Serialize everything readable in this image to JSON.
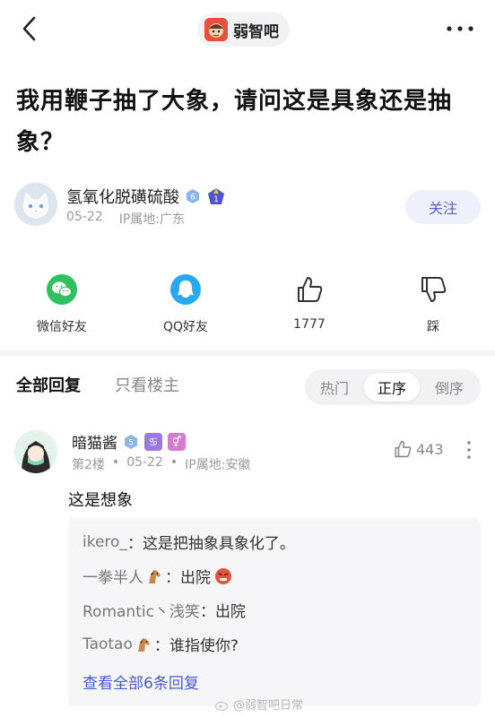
{
  "topbar": {
    "forum_name": "弱智吧"
  },
  "post": {
    "title": "我用鞭子抽了大象，请问这是具象还是抽象？"
  },
  "author": {
    "name": "氢氧化脱磺硫酸",
    "level": "6",
    "date": "05-22",
    "ip": "IP属地:广东",
    "follow_label": "关注"
  },
  "actions": {
    "wechat": "微信好友",
    "qq": "QQ好友",
    "likes": "1777",
    "dislike": "踩"
  },
  "reply_tabs": {
    "all": "全部回复",
    "op_only": "只看楼主",
    "sort": [
      "热门",
      "正序",
      "倒序"
    ],
    "active_sort": "正序"
  },
  "comment": {
    "name": "暗猫酱",
    "level": "5",
    "floor": "第2楼",
    "date": "05-22",
    "ip": "IP属地:安徽",
    "likes": "443",
    "text": "这是想象",
    "sub_replies": [
      {
        "user": "ikero_",
        "text": "这是把抽象具象化了。",
        "emoji": ""
      },
      {
        "user": "一拳半人",
        "text": "出院",
        "emoji": ""
      },
      {
        "user": "Romantic丶浅笑",
        "text": "出院",
        "emoji": ""
      },
      {
        "user": "Taotao",
        "text": "谁指使你?",
        "emoji": ""
      }
    ],
    "view_all": "查看全部6条回复"
  },
  "watermark": "@弱智吧日常",
  "colors": {
    "accent": "#5b62d8",
    "link": "#4a59d4",
    "wechat": "#2fc160",
    "qq": "#29a8f2"
  },
  "icons": [
    "chevron-left-icon",
    "more-icon",
    "wechat-icon",
    "qq-icon",
    "thumb-up-icon",
    "thumb-down-icon"
  ]
}
